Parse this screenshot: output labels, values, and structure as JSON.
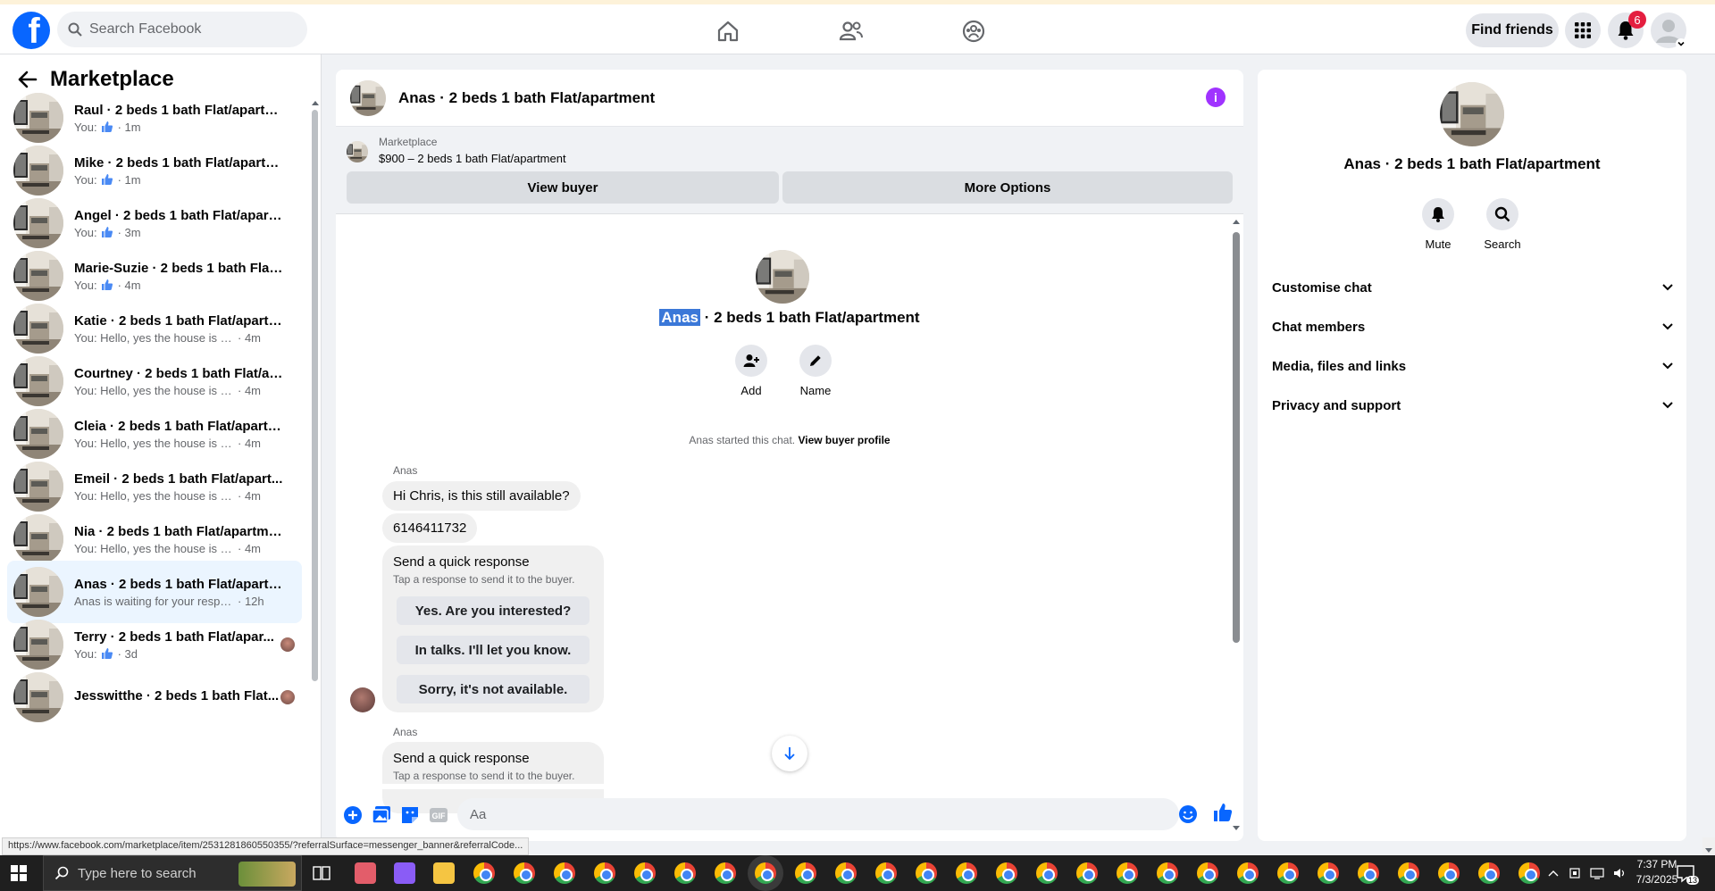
{
  "topbar": {
    "search_placeholder": "Search Facebook",
    "find_friends": "Find friends",
    "notification_count": "6",
    "brand_color": "#0866ff"
  },
  "sidebar": {
    "title": "Marketplace",
    "conversations": [
      {
        "name": "Raul · 2 beds 1 bath Flat/apartm...",
        "prefix": "You:",
        "icon": "thumbs-up-icon",
        "message": "",
        "time": "· 1m",
        "active": false
      },
      {
        "name": "Mike · 2 beds 1 bath Flat/apartm...",
        "prefix": "You:",
        "icon": "thumbs-up-icon",
        "message": "",
        "time": "· 1m",
        "active": false
      },
      {
        "name": "Angel · 2 beds 1 bath Flat/apart...",
        "prefix": "You:",
        "icon": "thumbs-up-icon",
        "message": "",
        "time": "· 3m",
        "active": false
      },
      {
        "name": "Marie-Suzie · 2 beds 1 bath Flat/...",
        "prefix": "You:",
        "icon": "thumbs-up-icon",
        "message": "",
        "time": "· 4m",
        "active": false
      },
      {
        "name": "Katie · 2 beds 1 bath Flat/apartm...",
        "prefix": "",
        "icon": "",
        "message": "You: Hello, yes the house is still av...",
        "time": "· 4m",
        "active": false
      },
      {
        "name": "Courtney · 2 beds 1 bath Flat/ap...",
        "prefix": "",
        "icon": "",
        "message": "You: Hello, yes the house is still av...",
        "time": "· 4m",
        "active": false
      },
      {
        "name": "Cleia · 2 beds 1 bath Flat/apartm...",
        "prefix": "",
        "icon": "",
        "message": "You: Hello, yes the house is still av...",
        "time": "· 4m",
        "active": false
      },
      {
        "name": "Emeil · 2 beds 1 bath Flat/apart...",
        "prefix": "",
        "icon": "",
        "message": "You: Hello, yes the house is still av...",
        "time": "· 4m",
        "active": false
      },
      {
        "name": "Nia · 2 beds 1 bath Flat/apartment",
        "prefix": "",
        "icon": "",
        "message": "You: Hello, yes the house is still av...",
        "time": "· 4m",
        "active": false
      },
      {
        "name": "Anas · 2 beds 1 bath Flat/apartm...",
        "prefix": "",
        "icon": "",
        "message": "Anas is waiting for your response.",
        "time": "· 12h",
        "active": true
      },
      {
        "name": "Terry · 2 beds 1 bath Flat/apar...",
        "prefix": "You:",
        "icon": "thumbs-up-icon",
        "message": "",
        "time": "· 3d",
        "active": false
      },
      {
        "name": "Jesswitthe · 2 beds 1 bath Flat...",
        "prefix": "",
        "icon": "",
        "message": "",
        "time": "",
        "active": false
      }
    ]
  },
  "chat": {
    "header_title": "Anas · 2 beds 1 bath Flat/apartment",
    "banner_label": "Marketplace",
    "banner_listing": "$900 – 2 beds 1 bath Flat/apartment",
    "view_buyer": "View buyer",
    "more_options": "More Options",
    "center_name": "Anas",
    "center_rest": " · 2 beds 1 bath Flat/apartment",
    "add_label": "Add",
    "name_label": "Name",
    "started_text": "Anas started this chat. ",
    "view_profile": "View buyer profile",
    "sender": "Anas",
    "msg1": "Hi Chris, is this still available?",
    "msg2": "6146411732",
    "qr_title": "Send a quick response",
    "qr_sub": "Tap a response to send it to the buyer.",
    "qr_options": [
      "Yes. Are you interested?",
      "In talks. I'll let you know.",
      "Sorry, it's not available."
    ],
    "composer_placeholder": "Aa"
  },
  "rpanel": {
    "title": "Anas · 2 beds 1 bath Flat/apartment",
    "mute": "Mute",
    "search": "Search",
    "rows": [
      "Customise chat",
      "Chat members",
      "Media, files and links",
      "Privacy and support"
    ]
  },
  "status_url": "https://www.facebook.com/marketplace/item/2531281860550355/?referralSurface=messenger_banner&referralCode...",
  "taskbar": {
    "search_placeholder": "Type here to search",
    "time": "7:37 PM",
    "date": "7/3/2025",
    "notif_count": "13"
  }
}
